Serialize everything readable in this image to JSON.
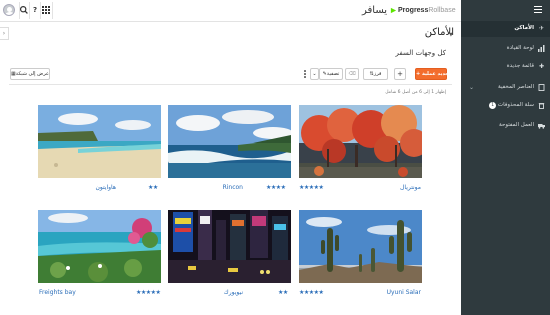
{
  "topbar": {
    "brand_prefix": "Progress",
    "brand_suffix": "Rollbase",
    "app_title": "يسافر",
    "help_label": "?",
    "icons": [
      "avatar",
      "search-icon",
      "help-icon",
      "apps-grid-icon"
    ]
  },
  "sidebar": {
    "items": [
      {
        "label": "الأماكن",
        "icon": "plane-icon",
        "active": true
      },
      {
        "label": "لوحة القيادة",
        "icon": "chart-icon",
        "active": false
      },
      {
        "label": "قائمة جديدة",
        "icon": "plus-icon",
        "active": false
      },
      {
        "label": "العناصر المخفية",
        "icon": "file-icon",
        "active": false,
        "expandable": true
      },
      {
        "label": "سلة المحذوفات",
        "icon": "trash-icon",
        "active": false,
        "badge": "1"
      },
      {
        "label": "العمل المفتوحة",
        "icon": "truck-icon",
        "active": false
      }
    ]
  },
  "header": {
    "title": "الأماكن",
    "subtitle": "كل وجهات السفر"
  },
  "toolbar": {
    "new_label": "+ جديد عملية",
    "add_label": "+",
    "sort_label": "فرز",
    "delete_label": "🗑",
    "filter_label": "تصفية",
    "view_label": "عرض إلى شبكة"
  },
  "info_line": "إظهار 1 إلى 6 من أصل 6 شامل",
  "cards": [
    {
      "name": "مونتريال",
      "rating": 5,
      "scene": "autumn"
    },
    {
      "name": "Rincon",
      "rating": 4,
      "scene": "surf"
    },
    {
      "name": "هاوايتون",
      "rating": 2,
      "scene": "beach"
    },
    {
      "name": "Uyuni Salar",
      "rating": 5,
      "scene": "cactus"
    },
    {
      "name": "نيويورك",
      "rating": 2,
      "scene": "city"
    },
    {
      "name": "Freights bay",
      "rating": 5,
      "scene": "bay"
    }
  ],
  "colors": {
    "accent": "#f36d2d",
    "sidebar_bg": "#2f3a3e",
    "link": "#2a6db8"
  }
}
